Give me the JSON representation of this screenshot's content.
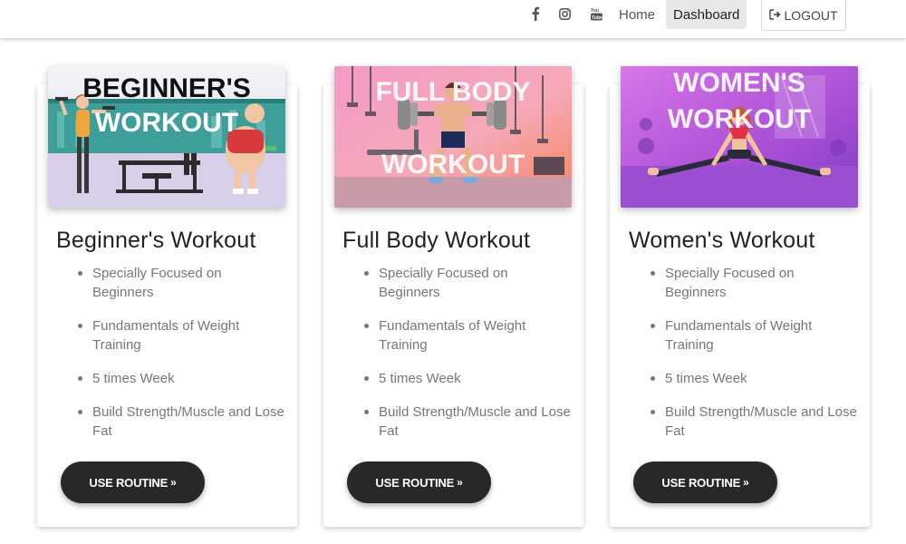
{
  "nav": {
    "social": [
      {
        "name": "facebook-icon"
      },
      {
        "name": "instagram-icon"
      },
      {
        "name": "youtube-icon"
      }
    ],
    "home_label": "Home",
    "dashboard_label": "Dashboard",
    "logout_label": "LOGOUT"
  },
  "cards": [
    {
      "image_text": [
        "BEGINNER'S",
        "WORKOUT"
      ],
      "title": "Beginner's Workout",
      "features": [
        "Specially Focused on Beginners",
        "Fundamentals of Weight Training",
        "5 times Week",
        "Build Strength/Muscle and Lose Fat"
      ],
      "button_label": "USE ROUTINE"
    },
    {
      "image_text": [
        "FULL BODY",
        "WORKOUT"
      ],
      "title": "Full Body Workout",
      "features": [
        "Specially Focused on Beginners",
        "Fundamentals of Weight Training",
        "5 times Week",
        "Build Strength/Muscle and Lose Fat"
      ],
      "button_label": "USE ROUTINE"
    },
    {
      "image_text": [
        "WOMEN'S",
        "WORKOUT"
      ],
      "title": "Women's Workout",
      "features": [
        "Specially Focused on Beginners",
        "Fundamentals of Weight Training",
        "5 times Week",
        "Build Strength/Muscle and Lose Fat"
      ],
      "button_label": "USE ROUTINE"
    }
  ],
  "colors": {
    "button_bg": "#282828",
    "nav_active_bg": "#e8e8e8",
    "feature_text": "#777777"
  }
}
